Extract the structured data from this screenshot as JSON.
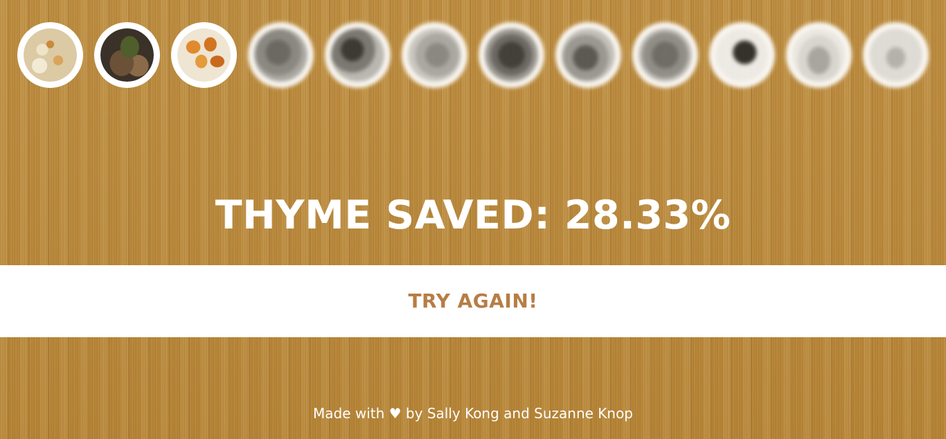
{
  "thumbnails": [
    {
      "icon": "food-photo-icon",
      "state": "revealed"
    },
    {
      "icon": "food-photo-icon",
      "state": "revealed"
    },
    {
      "icon": "food-photo-icon",
      "state": "revealed"
    },
    {
      "icon": "food-photo-icon",
      "state": "blurred"
    },
    {
      "icon": "food-photo-icon",
      "state": "blurred"
    },
    {
      "icon": "food-photo-icon",
      "state": "blurred"
    },
    {
      "icon": "food-photo-icon",
      "state": "blurred"
    },
    {
      "icon": "food-photo-icon",
      "state": "blurred"
    },
    {
      "icon": "food-photo-icon",
      "state": "blurred"
    },
    {
      "icon": "food-photo-icon",
      "state": "blurred"
    },
    {
      "icon": "food-photo-icon",
      "state": "blurred"
    },
    {
      "icon": "food-photo-icon",
      "state": "blurred"
    }
  ],
  "result": {
    "score_text": "THYME SAVED: 28.33%"
  },
  "actions": {
    "retry_label": "TRY AGAIN!"
  },
  "footer": {
    "credit_text": "Made with ♥ by Sally Kong and Suzanne Knop"
  },
  "colors": {
    "accent": "#b77d45",
    "wood": "#b98a3f",
    "text": "#ffffff"
  }
}
